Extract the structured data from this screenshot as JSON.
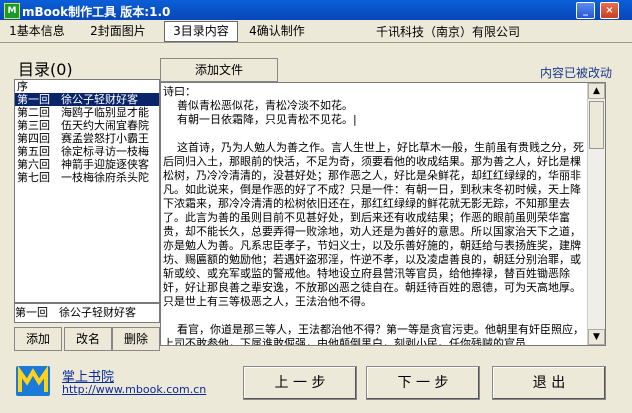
{
  "window": {
    "title": "mBook制作工具 版本:1.0"
  },
  "tabs": [
    {
      "label": "1基本信息"
    },
    {
      "label": "2封面图片"
    },
    {
      "label": "3目录内容"
    },
    {
      "label": "4确认制作"
    }
  ],
  "company": "千讯科技（南京）有限公司",
  "directory": {
    "title": "目录(0)",
    "header": "序",
    "items": [
      "第一回　徐公子轻财好客",
      "第二回　海鸥子临别显才能",
      "第三回　伍天约大闹宜春院",
      "第四回　赛孟尝怒打小霸王",
      "第五回　徐定标寻访一枝梅",
      "第六回　神箭手迎旋逐侠客",
      "第七回　一枝梅徐府杀头陀"
    ],
    "current": "第一回　徐公子轻财好客",
    "buttons": {
      "add": "添加",
      "rename": "改名",
      "delete": "删除"
    }
  },
  "editor": {
    "add_file": "添加文件",
    "status": "内容已被改动",
    "content": "诗曰：\n    善似青松恶似花，青松冷淡不如花。\n    有朝一日依霜降，只见青松不见花。|\n\n    这首诗，乃为人勉人为善之作。言人生世上，好比草木一般，生前虽有贵贱之分，死后同归入土，那眼前的快活，不足为奇，须要看他的收成结果。那为善之人，好比是棵松树，乃冷冷清清的，没甚好处；那作恶之人，好比是朵鲜花，却红红绿绿的，华丽非凡。如此说来，倒是作恶的好了不成？只是一件：有朝一日，到秋末冬初时候，天上降下浓霜来，那冷冷清清的松树依旧还在，那红红绿绿的鲜花就无影无踪，不知那里去了。此言为善的虽则目前不见甚好处，到后来还有收成结果；作恶的眼前虽则荣华富贵，却不能长久，总要弄得一败涂地，劝人还是为善好的意思。所以国家治天下之道，亦是勉人为善。凡系忠臣孝子，节妇义士，以及乐善好施的，朝廷给与表扬旌奖，建牌坊、赐匾额的勉励他；若遇奸盗邪淫，忤逆不孝，以及凌虐善良的，朝廷分别治罪，或斩或绞、或充军或监的警戒他。特地设立府县营汛等官员，给他捧禄，替百姓锄恶除奸，好让那良善之辈安逸，不放那凶恶之徒自在。朝廷待百姓的恩德，可为天高地厚。只是世上有三等极恶之人，王法治他不得。\n\n    看官，你道是那三等人，王法都治他不得？第一等是贪官污吏。他朝里有奸臣照应，上司不敢参他，下属谁敢倔强，由他颠倒黑白，刻剥小民。任你残贼的官员"
  },
  "footer": {
    "brand": "掌上书院",
    "url": "http://www.mbook.com.cn",
    "prev": "上  一  步",
    "next": "下  一  步",
    "exit": "退  出"
  }
}
